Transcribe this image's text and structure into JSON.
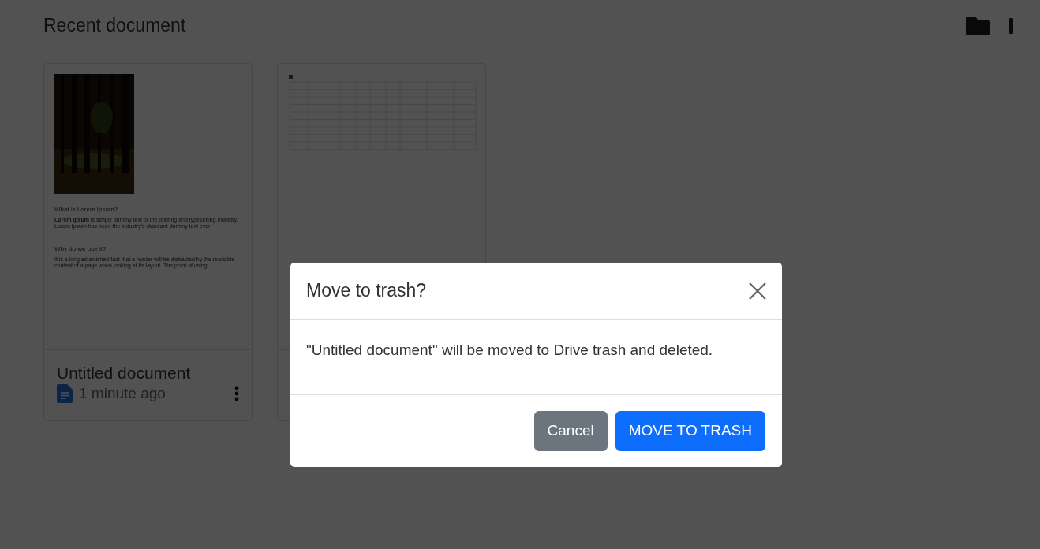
{
  "page": {
    "title": "Recent document"
  },
  "documents": [
    {
      "kind": "text",
      "title": "Untitled document",
      "time": "1 minute ago",
      "preview": [
        {
          "heading": "What is Lorem Ipsum?",
          "paragraph": "**Lorem Ipsum** is simply dummy text of the printing and typesetting industry. Lorem Ipsum has been the industry's standard dummy text ever"
        },
        {
          "heading": "Why do we use it?",
          "paragraph": "It is a long established fact that a reader will be distracted by the readable content of a page when looking at its layout. The point of using"
        }
      ]
    },
    {
      "kind": "sheet"
    }
  ],
  "dialog": {
    "title": "Move to trash?",
    "message": "\"Untitled document\" will be moved to Drive trash and deleted.",
    "buttons": [
      {
        "label": "Cancel",
        "kind": "secondary"
      },
      {
        "label": "MOVE TO TRASH",
        "kind": "primary"
      }
    ]
  }
}
